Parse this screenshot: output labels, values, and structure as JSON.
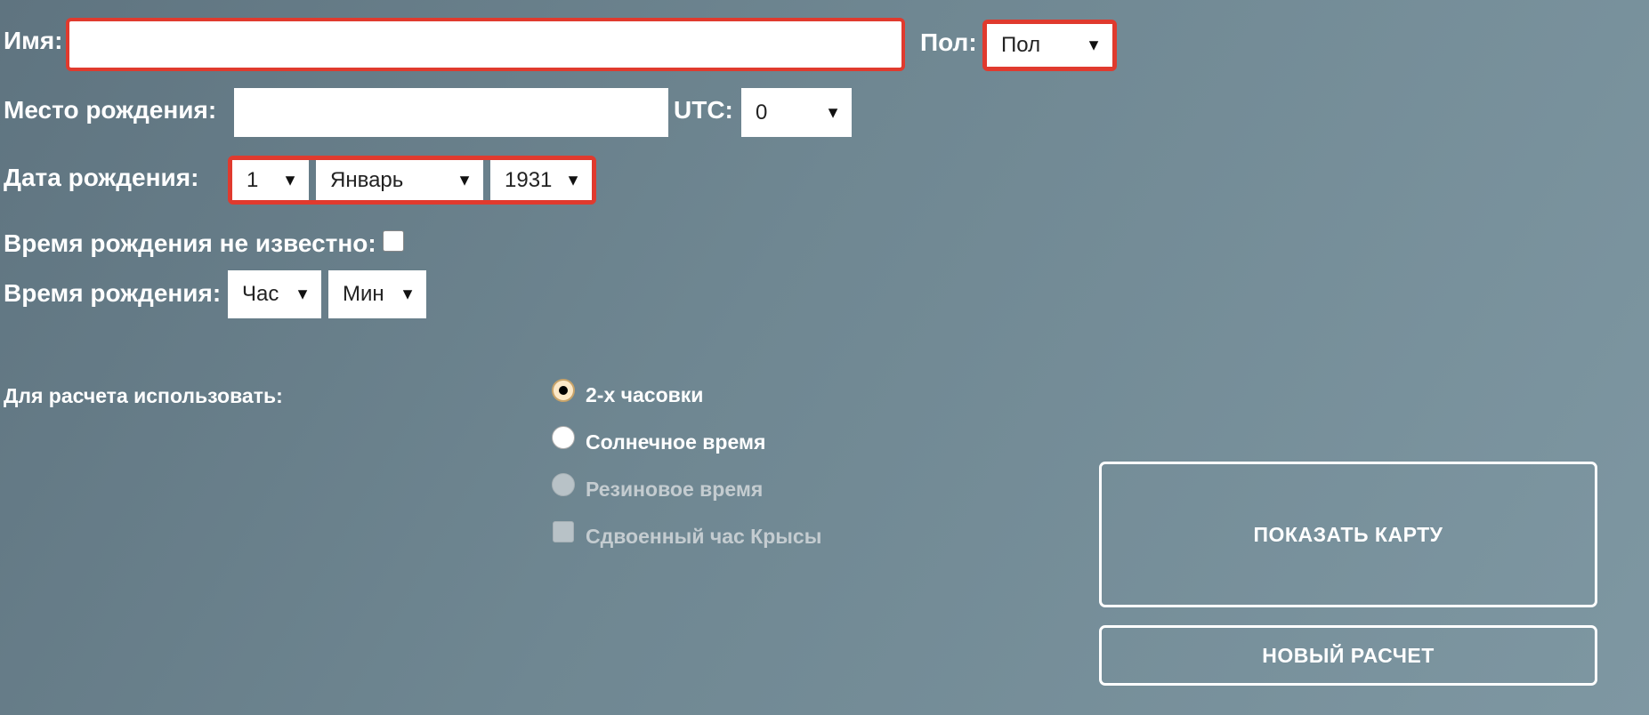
{
  "form": {
    "name_label": "Имя:",
    "name_value": "",
    "gender_label": "Пол:",
    "gender_selected": "Пол",
    "birthplace_label": "Место рождения:",
    "birthplace_value": "",
    "utc_label": "UTC:",
    "utc_selected": "0",
    "birthdate_label": "Дата рождения:",
    "day_selected": "1",
    "month_selected": "Январь",
    "year_selected": "1931",
    "unknown_time_label": "Время рождения не известно:",
    "unknown_time_checked": false,
    "birthtime_label": "Время рождения:",
    "hour_selected": "Час",
    "minute_selected": "Мин"
  },
  "calc": {
    "use_label": "Для расчета использовать:",
    "options": [
      {
        "label": "2-х часовки",
        "type": "radio",
        "checked": true,
        "disabled": false
      },
      {
        "label": "Солнечное время",
        "type": "radio",
        "checked": false,
        "disabled": false
      },
      {
        "label": "Резиновое время",
        "type": "radio",
        "checked": false,
        "disabled": true
      },
      {
        "label": "Сдвоенный час Крысы",
        "type": "checkbox",
        "checked": false,
        "disabled": true
      }
    ]
  },
  "buttons": {
    "show_map": "ПОКАЗАТЬ КАРТУ",
    "new_calc": "НОВЫЙ РАСЧЕТ"
  },
  "icons": {
    "dropdown": "caret-down-icon"
  },
  "colors": {
    "error_border": "#e03a2e",
    "background_start": "#5f7480",
    "background_end": "#7e97a2"
  }
}
